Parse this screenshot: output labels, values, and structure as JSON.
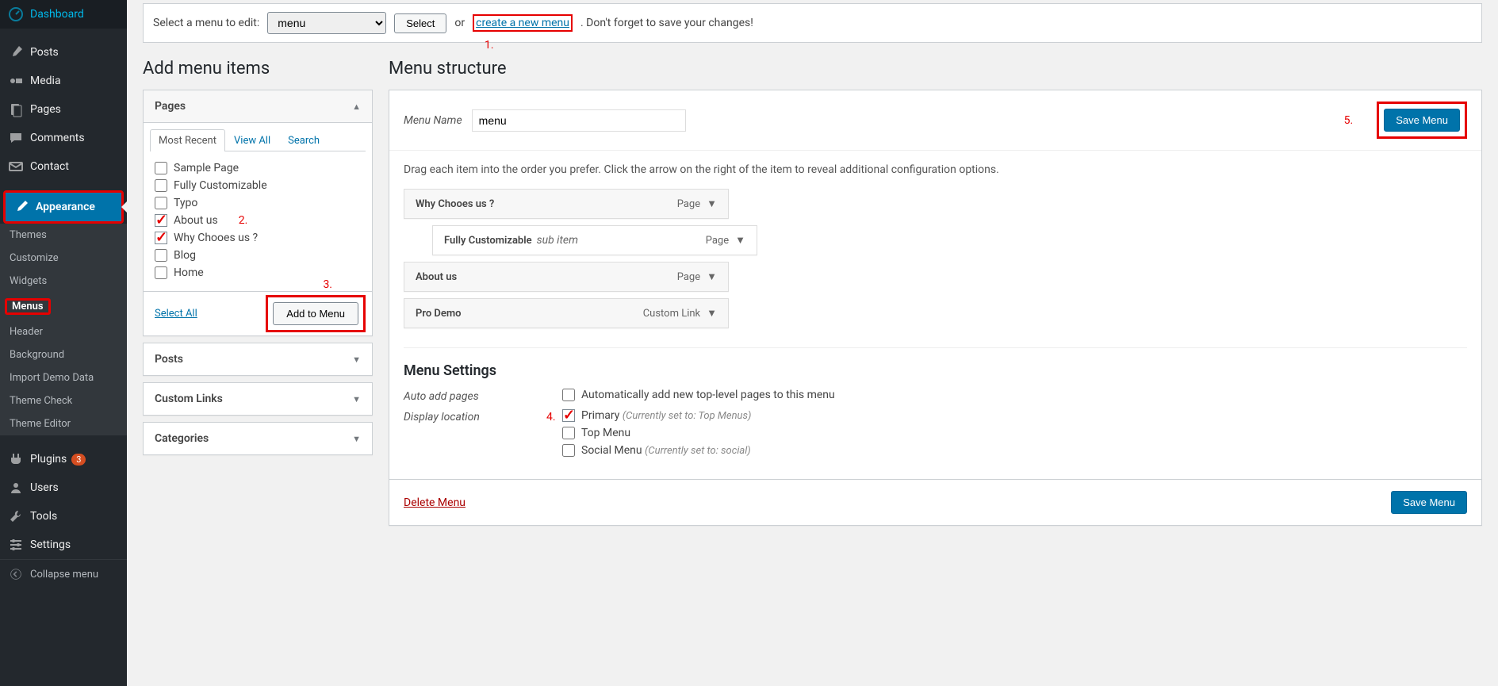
{
  "sidebar": {
    "items": [
      {
        "label": "Dashboard",
        "icon": "dashboard-icon"
      },
      {
        "label": "Posts",
        "icon": "pin-icon"
      },
      {
        "label": "Media",
        "icon": "media-icon"
      },
      {
        "label": "Pages",
        "icon": "pages-icon"
      },
      {
        "label": "Comments",
        "icon": "comments-icon"
      },
      {
        "label": "Contact",
        "icon": "mail-icon"
      },
      {
        "label": "Appearance",
        "icon": "brush-icon",
        "active": true
      },
      {
        "label": "Plugins",
        "icon": "plug-icon",
        "badge": "3"
      },
      {
        "label": "Users",
        "icon": "users-icon"
      },
      {
        "label": "Tools",
        "icon": "tools-icon"
      },
      {
        "label": "Settings",
        "icon": "settings-icon"
      }
    ],
    "appearance_sub": [
      "Themes",
      "Customize",
      "Widgets",
      "Menus",
      "Header",
      "Background",
      "Import Demo Data",
      "Theme Check",
      "Theme Editor"
    ],
    "collapse_label": "Collapse menu"
  },
  "top": {
    "label": "Select a menu to edit:",
    "selected": "menu",
    "select_btn": "Select",
    "or": "or",
    "create_link": "create a new menu",
    "dont_forget": ". Don't forget to save your changes!"
  },
  "annotations": {
    "a1": "1.",
    "a2": "2.",
    "a3": "3.",
    "a4": "4.",
    "a5": "5."
  },
  "left": {
    "heading": "Add menu items",
    "pages_title": "Pages",
    "tabs": [
      "Most Recent",
      "View All",
      "Search"
    ],
    "page_items": [
      {
        "label": "Sample Page",
        "checked": false
      },
      {
        "label": "Fully Customizable",
        "checked": false
      },
      {
        "label": "Typo",
        "checked": false
      },
      {
        "label": "About us",
        "checked": true
      },
      {
        "label": "Why Chooes us ?",
        "checked": true
      },
      {
        "label": "Blog",
        "checked": false
      },
      {
        "label": "Home",
        "checked": false
      }
    ],
    "select_all": "Select All",
    "add_btn": "Add to Menu",
    "other_panels": [
      "Posts",
      "Custom Links",
      "Categories"
    ]
  },
  "right": {
    "heading": "Menu structure",
    "menu_name_label": "Menu Name",
    "menu_name_value": "menu",
    "save_btn": "Save Menu",
    "hint": "Drag each item into the order you prefer. Click the arrow on the right of the item to reveal additional configuration options.",
    "items": [
      {
        "title": "Why Chooes us ?",
        "type": "Page",
        "sub": false
      },
      {
        "title": "Fully Customizable",
        "subtag": "sub item",
        "type": "Page",
        "sub": true
      },
      {
        "title": "About us",
        "type": "Page",
        "sub": false
      },
      {
        "title": "Pro Demo",
        "type": "Custom Link",
        "sub": false
      }
    ],
    "settings_title": "Menu Settings",
    "auto_add_label": "Auto add pages",
    "auto_add_opt": "Automatically add new top-level pages to this menu",
    "display_loc_label": "Display location",
    "locations": [
      {
        "label": "Primary",
        "meta": "(Currently set to: Top Menus)",
        "checked": true
      },
      {
        "label": "Top Menu",
        "meta": "",
        "checked": false
      },
      {
        "label": "Social Menu",
        "meta": "(Currently set to: social)",
        "checked": false
      }
    ],
    "delete_link": "Delete Menu"
  }
}
